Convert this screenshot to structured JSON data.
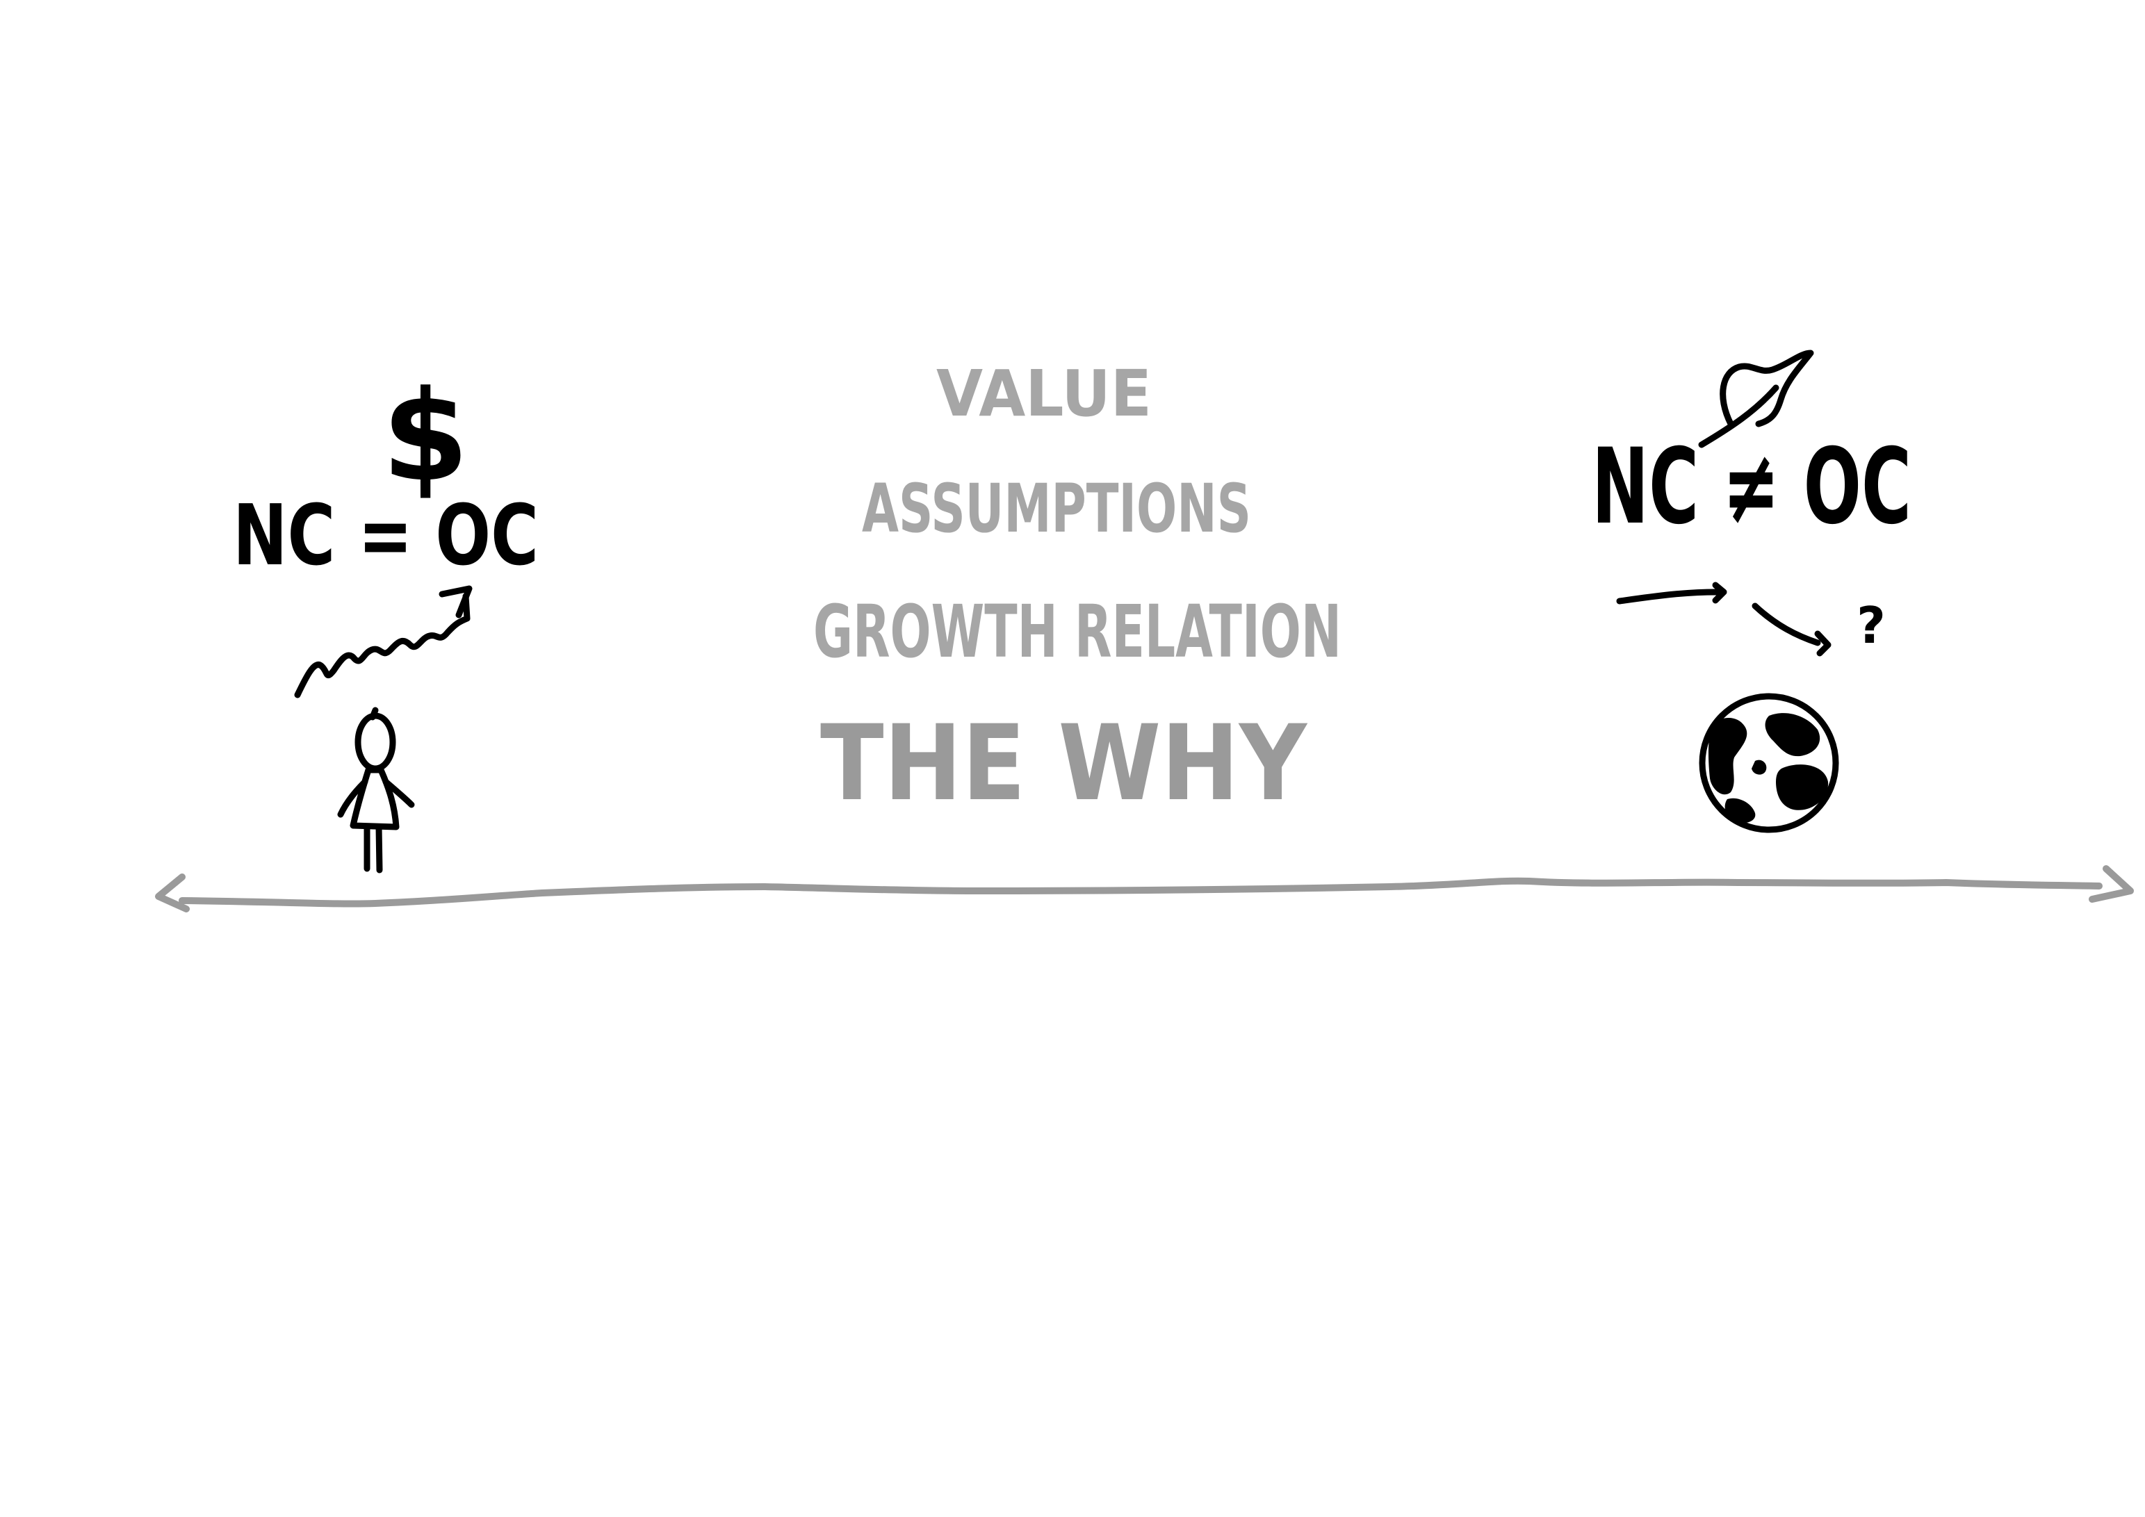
{
  "center": {
    "line1": "VALUE",
    "line2": "ASSUMPTIONS",
    "line3": "GROWTH RELATION",
    "line4": "THE WHY"
  },
  "left": {
    "symbol": "$",
    "equation": "NC = OC"
  },
  "right": {
    "equation": "NC ≠ OC",
    "question": "?"
  },
  "colors": {
    "ink": "#000000",
    "gray_ink": "#9a9a9a",
    "background": "#ffffff"
  },
  "icons": [
    "dollar-icon",
    "person-icon",
    "rising-arrow-icon",
    "leaf-icon",
    "globe-icon",
    "double-arrow-icon"
  ]
}
